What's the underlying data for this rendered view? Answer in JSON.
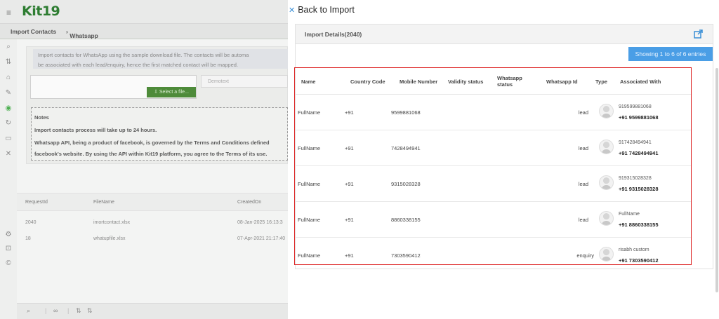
{
  "app": {
    "logo": "Kit19"
  },
  "breadcrumb": {
    "root": "Import Contacts",
    "current": "Whatsapp"
  },
  "background": {
    "info_line1": "Import contacts for WhatsApp using the sample download file. The contacts will be automa",
    "info_line2": "be associated with each lead/enquiry, hence the first matched contact will be mapped.",
    "select_file_label": "Select a file...",
    "demotext_placeholder": "Demotext",
    "notes": {
      "title": "Notes",
      "line1": "Import contacts process will take up to 24 hours.",
      "line2": "Whatsapp API, being a product of facebook, is governed by the Terms and Conditions defined",
      "line3": "facebook's website. By using the API within Kit19 platform, you agree to the Terms of its use."
    },
    "grid": {
      "headers": [
        "RequestId",
        "FileName",
        "CreatedOn"
      ],
      "rows": [
        [
          "2040",
          "imortcontact.xlsx",
          "08-Jan-2025 16:13:3"
        ],
        [
          "18",
          "whatupfile.xlsx",
          "07-Apr-2021 21:17:40"
        ]
      ]
    }
  },
  "drawer": {
    "back_label": "Back to Import",
    "card_title": "Import Details(2040)",
    "showing_label": "Showing 1 to 6 of 6 entries",
    "table": {
      "headers": {
        "name": "Name",
        "country_code": "Country Code",
        "mobile": "Mobile Number",
        "validity": "Validity status",
        "wa_status": "Whatsapp status",
        "wa_id": "Whatsapp Id",
        "type": "Type",
        "associated": "Associated With"
      },
      "rows": [
        {
          "name": "FullName",
          "cc": "+91",
          "mobile": "9599881068",
          "type": "lead",
          "assoc_name": "919599881068",
          "assoc_phone": "+91 9599881068"
        },
        {
          "name": "FullName",
          "cc": "+91",
          "mobile": "7428494941",
          "type": "lead",
          "assoc_name": "917428494941",
          "assoc_phone": "+91 7428494941"
        },
        {
          "name": "FullName",
          "cc": "+91",
          "mobile": "9315028328",
          "type": "lead",
          "assoc_name": "919315028328",
          "assoc_phone": "+91 9315028328"
        },
        {
          "name": "FullName",
          "cc": "+91",
          "mobile": "8860338155",
          "type": "lead",
          "assoc_name": "FullName",
          "assoc_phone": "+91 8860338155"
        },
        {
          "name": "FullName",
          "cc": "+91",
          "mobile": "7303590412",
          "type": "enquiry",
          "assoc_name": "risabh custom",
          "assoc_phone": "+91 7303590412"
        }
      ]
    }
  },
  "colors": {
    "brand_green": "#2e7d32",
    "accent_blue": "#4a9ee6",
    "highlight_red": "#dd2222"
  }
}
